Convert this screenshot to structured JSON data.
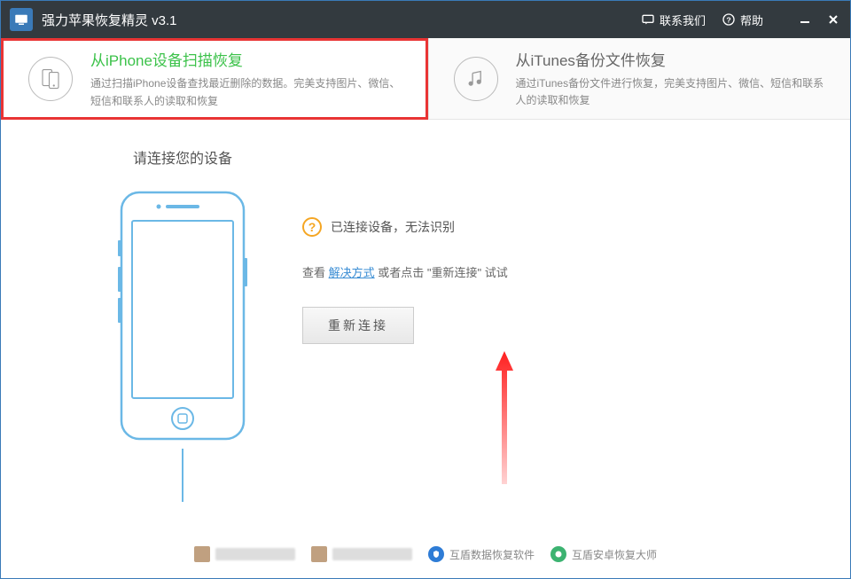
{
  "titlebar": {
    "title": "强力苹果恢复精灵 v3.1",
    "contact": "联系我们",
    "help": "帮助"
  },
  "modes": {
    "iphone": {
      "title": "从iPhone设备扫描恢复",
      "desc": "通过扫描iPhone设备查找最近删除的数据。完美支持图片、微信、短信和联系人的读取和恢复"
    },
    "itunes": {
      "title": "从iTunes备份文件恢复",
      "desc": "通过iTunes备份文件进行恢复，完美支持图片、微信、短信和联系人的读取和恢复"
    }
  },
  "content": {
    "prompt": "请连接您的设备",
    "status": "已连接设备，无法识别",
    "help_prefix": "查看 ",
    "help_link": "解决方式",
    "help_suffix": " 或者点击 \"重新连接\" 试试",
    "reconnect": "重新连接"
  },
  "footer": {
    "link1": "互盾数据恢复软件",
    "link2": "互盾安卓恢复大师"
  }
}
